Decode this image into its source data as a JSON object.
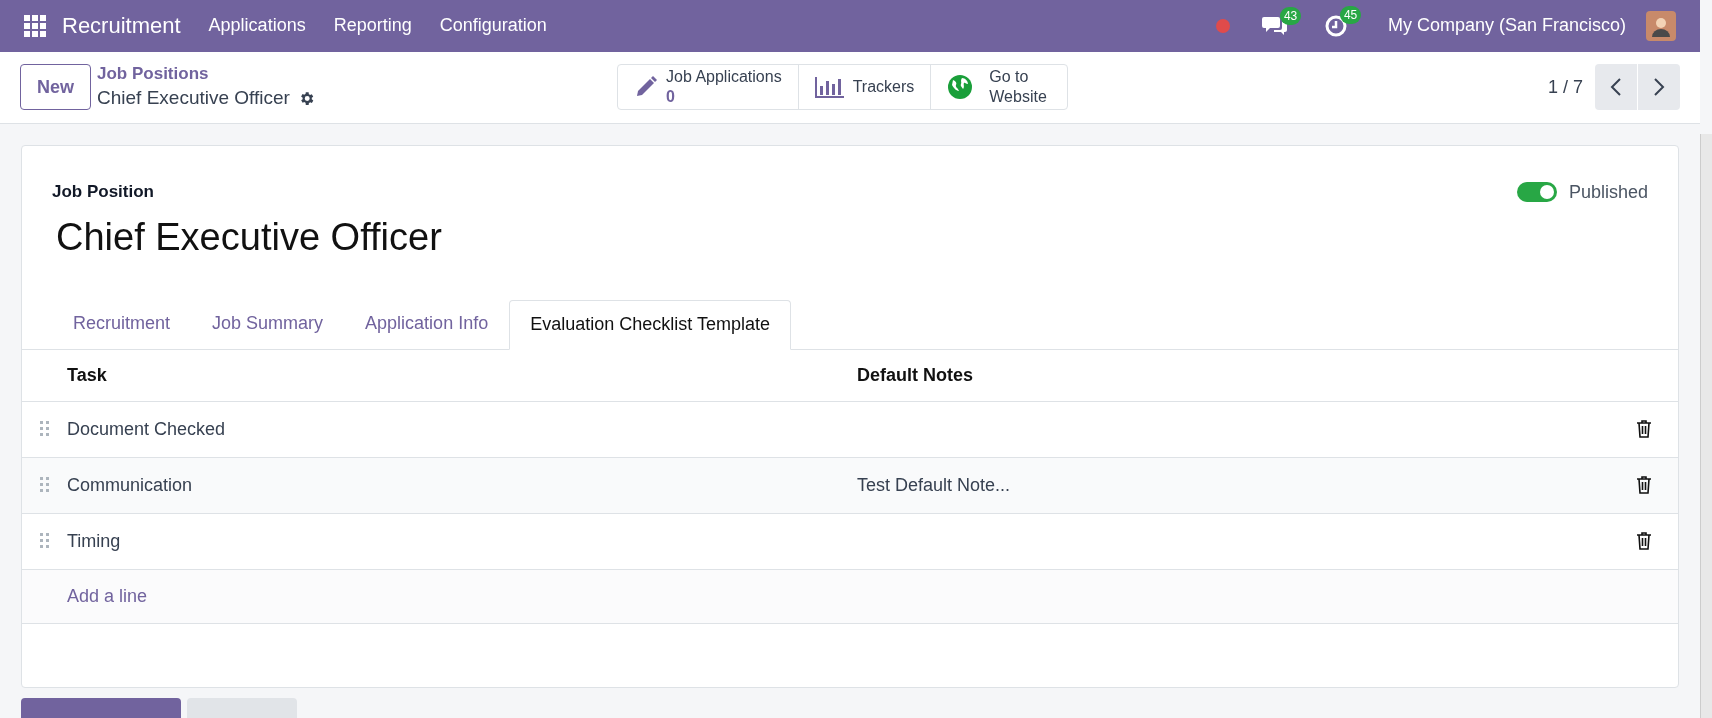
{
  "navbar": {
    "app_name": "Recruitment",
    "menus": [
      "Applications",
      "Reporting",
      "Configuration"
    ],
    "messages_count": "43",
    "activities_count": "45",
    "company": "My Company (San Francisco)"
  },
  "control_panel": {
    "new_button": "New",
    "breadcrumb": "Job Positions",
    "record_name": "Chief Executive Officer",
    "smart_buttons": [
      {
        "kind": "stat",
        "label": "Job Applications",
        "value": "0"
      },
      {
        "kind": "chart",
        "label": "Trackers"
      },
      {
        "kind": "globe",
        "label": "Go to Website"
      }
    ],
    "pager": "1 / 7"
  },
  "form": {
    "field_label": "Job Position",
    "title": "Chief Executive Officer",
    "published": {
      "label": "Published",
      "on": true
    },
    "tabs": [
      {
        "label": "Recruitment",
        "selected": false
      },
      {
        "label": "Job Summary",
        "selected": false
      },
      {
        "label": "Application Info",
        "selected": false
      },
      {
        "label": "Evaluation Checklist Template",
        "selected": true
      }
    ],
    "table": {
      "columns": [
        "Task",
        "Default Notes"
      ],
      "rows": [
        {
          "task": "Document Checked"
        },
        {
          "task": "Communication",
          "default_notes": "Test Default Note..."
        },
        {
          "task": "Timing"
        }
      ],
      "add_line": "Add a line"
    }
  }
}
